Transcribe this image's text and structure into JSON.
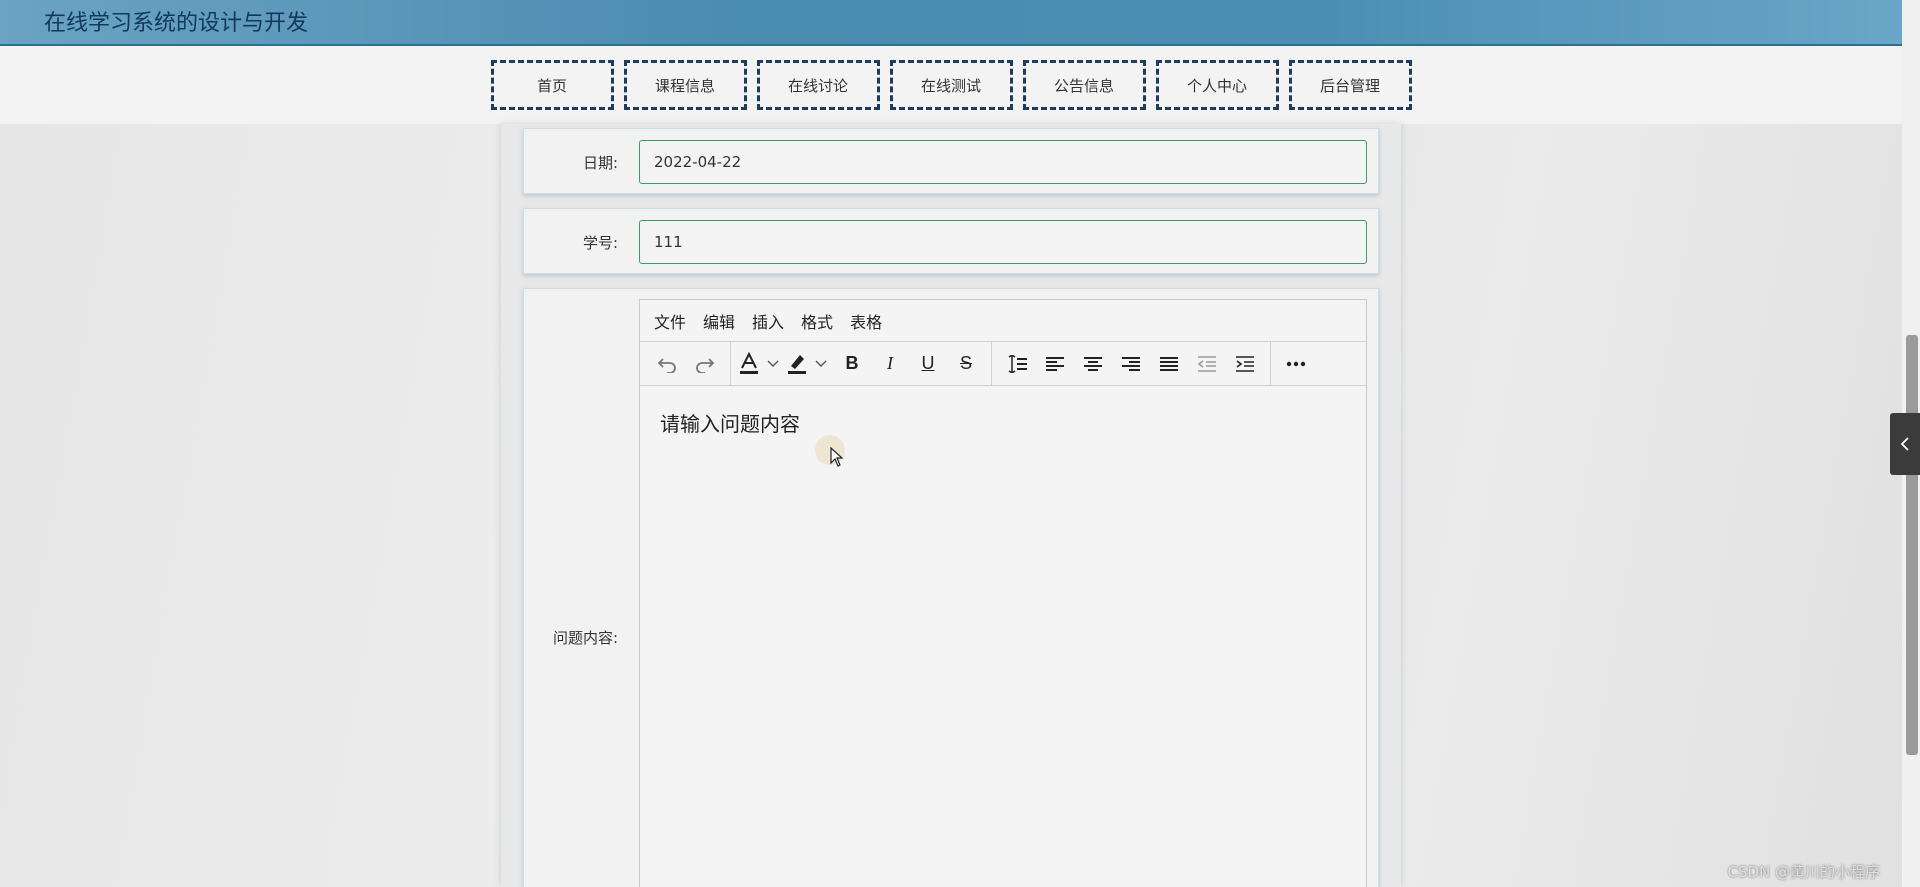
{
  "header": {
    "title": "在线学习系统的设计与开发"
  },
  "nav": {
    "items": [
      {
        "label": "首页"
      },
      {
        "label": "课程信息"
      },
      {
        "label": "在线讨论"
      },
      {
        "label": "在线测试"
      },
      {
        "label": "公告信息"
      },
      {
        "label": "个人中心"
      },
      {
        "label": "后台管理"
      }
    ]
  },
  "form": {
    "date": {
      "label": "日期:",
      "value": "2022-04-22"
    },
    "student_id": {
      "label": "学号:",
      "value": "111"
    },
    "question": {
      "label": "问题内容:",
      "placeholder": "请输入问题内容"
    }
  },
  "editor": {
    "menus": [
      "文件",
      "编辑",
      "插入",
      "格式",
      "表格"
    ],
    "toolbar": {
      "undo": "undo-icon",
      "redo": "redo-icon",
      "font_color": "font-color-icon",
      "highlight": "highlight-icon",
      "bold": "bold-icon",
      "italic": "italic-icon",
      "underline": "underline-icon",
      "strike": "strikethrough-icon",
      "line_height": "line-height-icon",
      "align_left": "align-left-icon",
      "align_center": "align-center-icon",
      "align_right": "align-right-icon",
      "justify": "justify-icon",
      "outdent": "outdent-icon",
      "indent": "indent-icon",
      "more": "more-icon"
    }
  },
  "watermark": "CSDN @黄川的小程序"
}
